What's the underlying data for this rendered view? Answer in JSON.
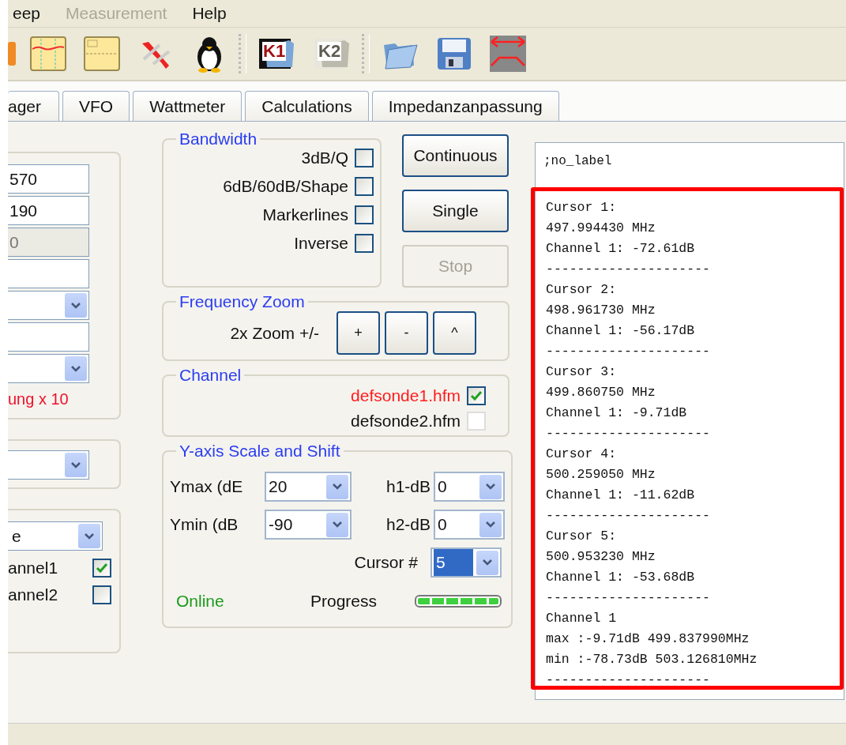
{
  "menu": [
    {
      "label": "eep",
      "disabled": false
    },
    {
      "label": "Measurement",
      "disabled": true
    },
    {
      "label": "Help",
      "disabled": false
    }
  ],
  "toolbar": {
    "folder_buttons": [
      {
        "label": "K1",
        "disabled": false
      },
      {
        "label": "K2",
        "disabled": true
      }
    ]
  },
  "tabs": [
    {
      "label": "ager",
      "selected": false
    },
    {
      "label": "VFO",
      "selected": false
    },
    {
      "label": "Wattmeter",
      "selected": false
    },
    {
      "label": "Calculations",
      "selected": false
    },
    {
      "label": "Impedanzanpassung",
      "selected": false
    }
  ],
  "left_panel": {
    "groups": [
      {
        "fields": [
          {
            "kind": "text",
            "value": "570",
            "disabled": false
          },
          {
            "kind": "text",
            "value": "190",
            "disabled": false
          },
          {
            "kind": "text",
            "value": "0",
            "disabled": true
          },
          {
            "kind": "text",
            "disabled": false
          },
          {
            "kind": "dropdown"
          },
          {
            "kind": "text",
            "disabled": false
          },
          {
            "kind": "dropdown"
          }
        ],
        "note": "ung x 10"
      },
      {
        "fields": [
          {
            "kind": "dropdown"
          }
        ]
      },
      {
        "fields": [
          {
            "kind": "dropdown",
            "value": "e"
          }
        ],
        "checkboxes": [
          {
            "label": "annel1",
            "checked": true
          },
          {
            "label": "annel2",
            "checked": false
          }
        ]
      }
    ]
  },
  "bandwidth": {
    "title": "Bandwidth",
    "options": [
      {
        "label": "3dB/Q",
        "checked": false
      },
      {
        "label": "6dB/60dB/Shape",
        "checked": false
      },
      {
        "label": "Markerlines",
        "checked": false
      },
      {
        "label": "Inverse",
        "checked": false
      }
    ]
  },
  "sweep_buttons": [
    {
      "label": "Continuous",
      "disabled": false
    },
    {
      "label": "Single",
      "disabled": false
    },
    {
      "label": "Stop",
      "disabled": true
    }
  ],
  "frequency_zoom": {
    "title": "Frequency Zoom",
    "label": "2x Zoom +/-",
    "buttons": [
      "+",
      "-",
      "^"
    ]
  },
  "channel": {
    "title": "Channel",
    "items": [
      {
        "label": "defsonde1.hfm",
        "checked": true,
        "highlighted": true
      },
      {
        "label": "defsonde2.hfm",
        "checked": false,
        "highlighted": false
      }
    ]
  },
  "y_axis": {
    "title": "Y-axis Scale and Shift",
    "rows": [
      {
        "label": "Ymax (dE",
        "value": "20",
        "offset_label": "h1-dB",
        "offset_value": "0"
      },
      {
        "label": "Ymin (dB",
        "value": "-90",
        "offset_label": "h2-dB",
        "offset_value": "0"
      }
    ],
    "cursor": {
      "label": "Cursor #",
      "value": "5"
    },
    "status": "Online",
    "progress": {
      "label": "Progress",
      "level": 1
    }
  },
  "label_box": ";no_label",
  "log": {
    "highlighted": true,
    "lines": [
      "Cursor 1:",
      "497.994430 MHz",
      "Channel 1: -72.61dB",
      "---------------------",
      "Cursor 2:",
      "498.961730 MHz",
      "Channel 1: -56.17dB",
      "---------------------",
      "Cursor 3:",
      "499.860750 MHz",
      "Channel 1: -9.71dB",
      "---------------------",
      "Cursor 4:",
      "500.259050 MHz",
      "Channel 1: -11.62dB",
      "---------------------",
      "Cursor 5:",
      "500.953230 MHz",
      "Channel 1: -53.68dB",
      "---------------------",
      "Channel 1",
      "max :-9.71dB 499.837990MHz",
      "min :-78.73dB 503.126810MHz",
      "---------------------"
    ]
  }
}
